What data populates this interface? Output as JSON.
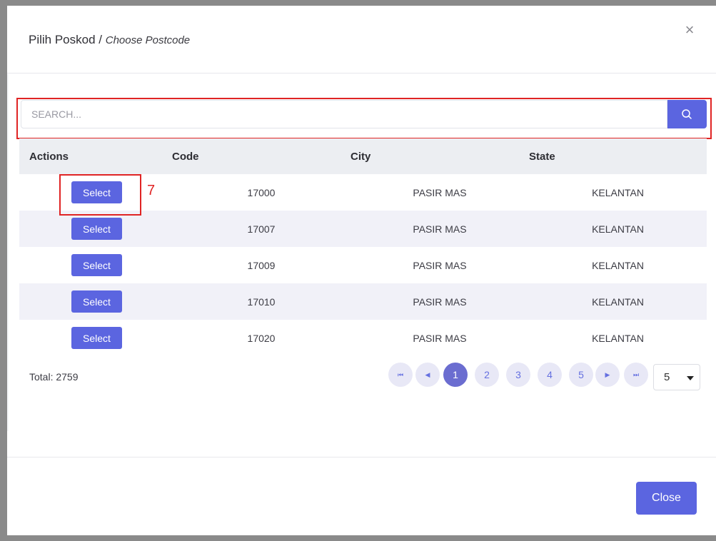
{
  "modal": {
    "title_main": "Pilih Poskod",
    "title_separator": " / ",
    "title_sub": "Choose Postcode",
    "close_icon": "×"
  },
  "search": {
    "placeholder": "SEARCH...",
    "value": "",
    "button_icon": "search-icon"
  },
  "table": {
    "columns": [
      "Actions",
      "Code",
      "City",
      "State"
    ],
    "rows": [
      {
        "action": "Select",
        "code": "17000",
        "city": "PASIR MAS",
        "state": "KELANTAN"
      },
      {
        "action": "Select",
        "code": "17007",
        "city": "PASIR MAS",
        "state": "KELANTAN"
      },
      {
        "action": "Select",
        "code": "17009",
        "city": "PASIR MAS",
        "state": "KELANTAN"
      },
      {
        "action": "Select",
        "code": "17010",
        "city": "PASIR MAS",
        "state": "KELANTAN"
      },
      {
        "action": "Select",
        "code": "17020",
        "city": "PASIR MAS",
        "state": "KELANTAN"
      }
    ]
  },
  "annotation": {
    "number": "7"
  },
  "footer_info": {
    "total": "Total: 2759"
  },
  "pagination": {
    "first": "⏮",
    "prev": "◀",
    "pages": [
      "1",
      "2",
      "3",
      "4",
      "5"
    ],
    "current": "1",
    "next": "▶",
    "last": "⏭",
    "page_size": "5"
  },
  "actions": {
    "close_label": "Close"
  },
  "colors": {
    "primary": "#5b65e0",
    "active_page": "#6b6dd0",
    "highlight": "#e02424",
    "alt_row": "#f1f1f8",
    "header_row": "#eceef2"
  }
}
